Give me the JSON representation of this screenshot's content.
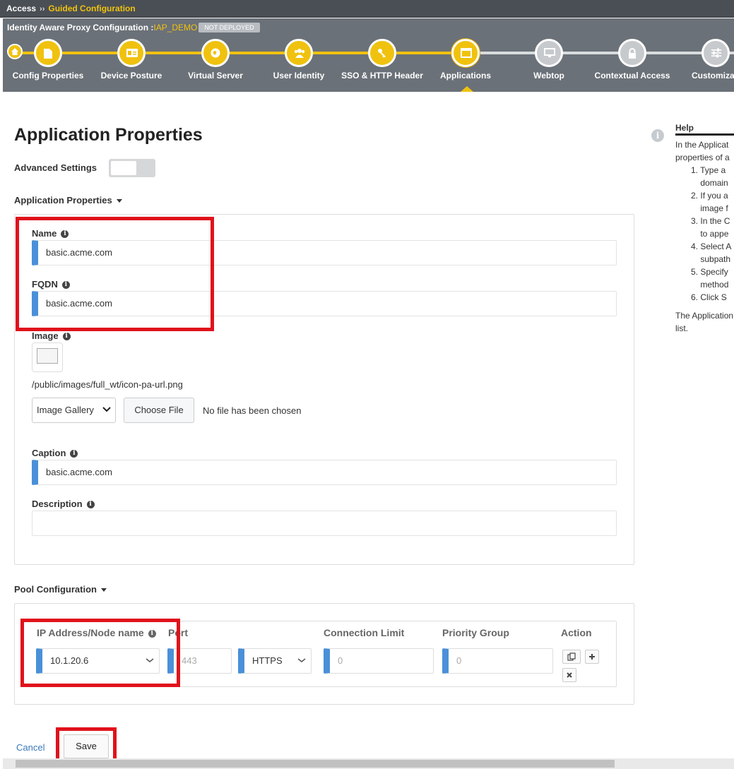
{
  "breadcrumb": {
    "root": "Access",
    "separator": "››",
    "current": "Guided Configuration"
  },
  "wizard": {
    "title_prefix": "Identity Aware Proxy Configuration :",
    "config_name": "IAP_DEMO",
    "status_badge": "NOT DEPLOYED",
    "steps": [
      {
        "label": "Config Properties",
        "icon": "document-icon",
        "state": "done"
      },
      {
        "label": "Device Posture",
        "icon": "id-card-icon",
        "state": "done"
      },
      {
        "label": "Virtual Server",
        "icon": "globe-icon",
        "state": "done"
      },
      {
        "label": "User Identity",
        "icon": "users-icon",
        "state": "done"
      },
      {
        "label": "SSO & HTTP Header",
        "icon": "key-icon",
        "state": "done"
      },
      {
        "label": "Applications",
        "icon": "window-icon",
        "state": "active"
      },
      {
        "label": "Webtop",
        "icon": "monitor-icon",
        "state": "pending"
      },
      {
        "label": "Contextual Access",
        "icon": "lock-icon",
        "state": "pending"
      },
      {
        "label": "Customizati",
        "icon": "sliders-icon",
        "state": "pending"
      }
    ]
  },
  "page": {
    "title": "Application Properties",
    "advanced_settings_label": "Advanced Settings",
    "advanced_settings_on": false
  },
  "app_section": {
    "header": "Application Properties",
    "name": {
      "label": "Name",
      "value": "basic.acme.com"
    },
    "fqdn": {
      "label": "FQDN",
      "value": "basic.acme.com"
    },
    "image": {
      "label": "Image",
      "path": "/public/images/full_wt/icon-pa-url.png",
      "gallery_select": "Image Gallery",
      "choose_button": "Choose File",
      "no_file_text": "No file has been chosen"
    },
    "caption": {
      "label": "Caption",
      "value": "basic.acme.com"
    },
    "description": {
      "label": "Description",
      "value": ""
    }
  },
  "pool_section": {
    "header": "Pool Configuration",
    "columns": {
      "ip": "IP Address/Node name",
      "port": "Port",
      "conn_limit": "Connection Limit",
      "priority": "Priority Group",
      "action": "Action"
    },
    "row": {
      "ip": "10.1.20.6",
      "port": "443",
      "protocol": "HTTPS",
      "conn_limit": "0",
      "priority": "0"
    }
  },
  "help": {
    "title": "Help",
    "intro": [
      "In the Applicat",
      "properties of a"
    ],
    "steps": [
      {
        "num": "1.",
        "lines": [
          "Type a",
          "domain"
        ]
      },
      {
        "num": "2.",
        "lines": [
          "If you a",
          "image f"
        ]
      },
      {
        "num": "3.",
        "lines": [
          "In the C",
          "to appe"
        ]
      },
      {
        "num": "4.",
        "lines": [
          "Select A",
          "subpath"
        ]
      },
      {
        "num": "5.",
        "lines": [
          "Specify",
          "method"
        ]
      },
      {
        "num": "6.",
        "lines": [
          "Click S"
        ]
      }
    ],
    "outro": [
      "The Application",
      "list."
    ]
  },
  "footer": {
    "cancel": "Cancel",
    "save": "Save"
  },
  "colors": {
    "accent": "#f0c20f",
    "header_bg": "#4a4f55",
    "wizard_bg": "#6b7178",
    "required_marker": "#4a90d9",
    "highlight": "#e0121b",
    "link": "#3b78b8"
  }
}
